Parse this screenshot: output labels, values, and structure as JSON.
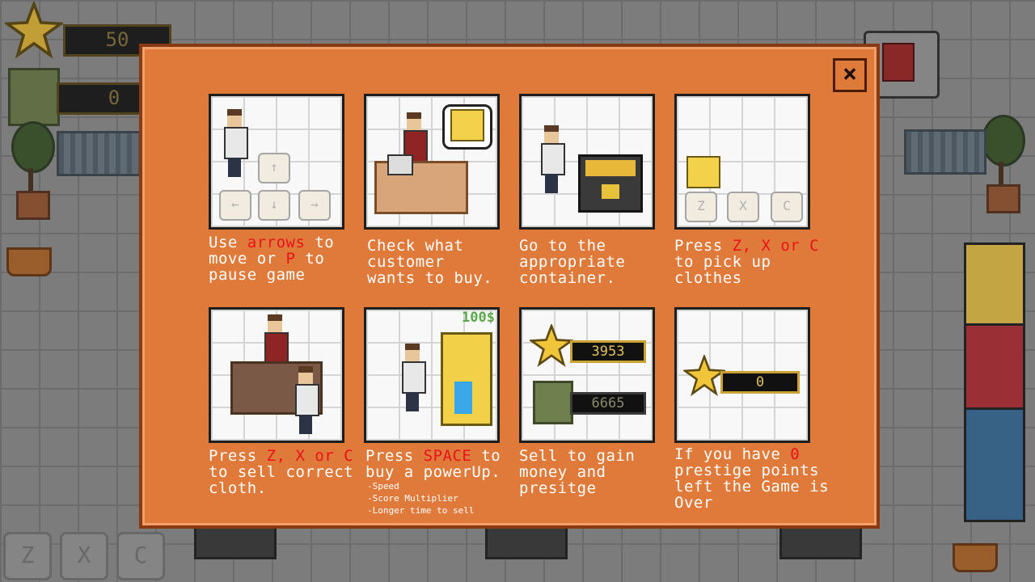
{
  "hud": {
    "stars_value": "50",
    "money_value": "0"
  },
  "bottom_keys": [
    "Z",
    "X",
    "C"
  ],
  "dialog": {
    "close_label": "×",
    "steps": [
      {
        "parts": [
          {
            "t": "Use "
          },
          {
            "t": "arrows",
            "hl": true
          },
          {
            "t": " to\nmove or "
          },
          {
            "t": "P",
            "hl": true
          },
          {
            "t": " to\npause game"
          }
        ]
      },
      {
        "parts": [
          {
            "t": "Check what\ncustomer\nwants to buy."
          }
        ]
      },
      {
        "parts": [
          {
            "t": "Go to the\nappropriate\ncontainer."
          }
        ]
      },
      {
        "parts": [
          {
            "t": "Press "
          },
          {
            "t": "Z, X or C",
            "hl": true
          },
          {
            "t": "\nto pick up\nclothes"
          }
        ]
      },
      {
        "parts": [
          {
            "t": "Press "
          },
          {
            "t": "Z, X or C",
            "hl": true
          },
          {
            "t": "\nto sell correct\ncloth."
          }
        ]
      },
      {
        "parts": [
          {
            "t": "Press "
          },
          {
            "t": "SPACE",
            "hl": true
          },
          {
            "t": " to\nbuy a powerUp."
          }
        ]
      },
      {
        "parts": [
          {
            "t": "Sell to gain\nmoney and\npresitge"
          }
        ]
      },
      {
        "parts": [
          {
            "t": "If you have "
          },
          {
            "t": "0",
            "hl": true
          },
          {
            "t": "\nprestige points\nleft the Game is\nOver"
          }
        ]
      }
    ],
    "powerups": [
      "-Speed",
      "-Score Multiplier",
      "-Longer time to sell"
    ],
    "card_labels": {
      "arrow_up": "↑",
      "arrow_left": "←",
      "arrow_down": "↓",
      "arrow_right": "→",
      "key_z": "Z",
      "key_x": "X",
      "key_c": "C",
      "price": "100$",
      "score_value": "3953",
      "money_value": "6665",
      "prestige_value": "0"
    }
  },
  "colors": {
    "dialog_bg": "#e07a3a",
    "highlight": "#e8121b",
    "caption": "#ffffff"
  }
}
